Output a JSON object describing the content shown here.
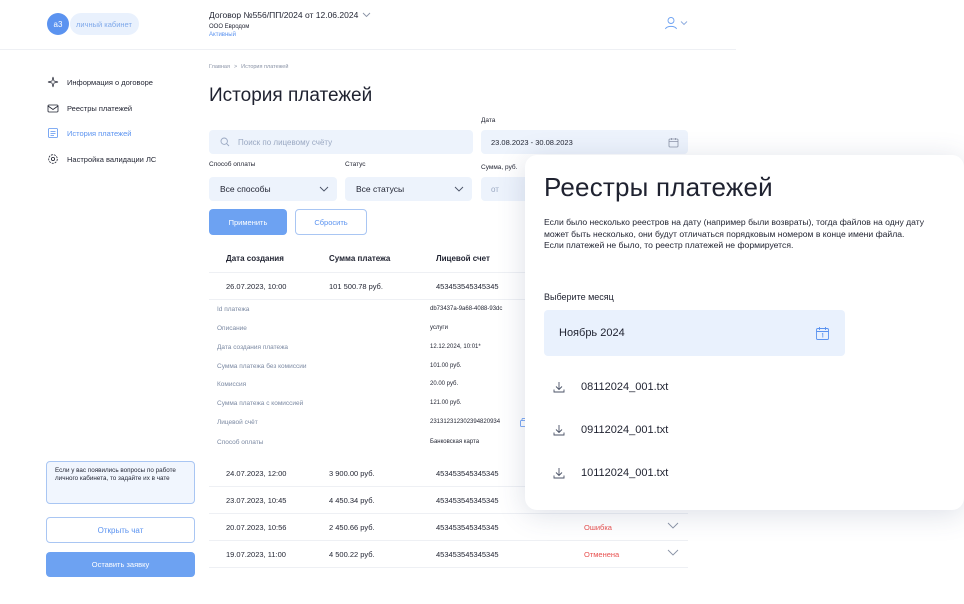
{
  "header": {
    "avatar_initials": "а3",
    "cabinet_label": "личный кабинет",
    "contract_title": "Договор №556/ПП/2024 от 12.06.2024",
    "org_name": "ООО Евродом",
    "contract_status": "Активный"
  },
  "sidebar": {
    "items": [
      {
        "label": "Информация о договоре",
        "icon": "sparkle-icon"
      },
      {
        "label": "Реестры платежей",
        "icon": "envelope-icon"
      },
      {
        "label": "История платежей",
        "icon": "list-icon"
      },
      {
        "label": "Настройка валидации ЛС",
        "icon": "gear-icon"
      }
    ],
    "help_text": "Если у вас появились вопросы по работе личного кабинета, то задайте их в чате",
    "chat_label": "Открыть чат",
    "request_label": "Оставить заявку"
  },
  "main": {
    "breadcrumbs": [
      "Главная",
      ">",
      "История платежей"
    ],
    "title": "История платежей",
    "search_placeholder": "Поиск по лицевому счёту",
    "date_label": "Дата",
    "date_value": "23.08.2023 - 30.08.2023",
    "payment_method_label": "Способ оплаты",
    "payment_method_value": "Все способы",
    "status_label": "Статус",
    "status_value": "Все статусы",
    "sum_label": "Сумма, руб.",
    "sum_from_placeholder": "от",
    "apply_label": "Применить",
    "reset_label": "Сбросить"
  },
  "table": {
    "columns": [
      "Дата создания",
      "Сумма платежа",
      "Лицевой счет"
    ],
    "first_row": {
      "date": "26.07.2023, 10:00",
      "sum": "101 500.78 руб.",
      "account": "453453545345345"
    },
    "details": [
      {
        "key": "Id платежа",
        "value": "db73437a-9a68-4088-93dc"
      },
      {
        "key": "Описание",
        "value": "услуги"
      },
      {
        "key": "Дата создания платежа",
        "value": "12.12.2024, 10:01*"
      },
      {
        "key": "Сумма платежа без комиссии",
        "value": "101.00 руб."
      },
      {
        "key": "Комиссия",
        "value": "20.00 руб."
      },
      {
        "key": "Сумма платежа с комиссией",
        "value": "121.00 руб."
      },
      {
        "key": "Лицевой счёт",
        "value": "231312312302394820934"
      },
      {
        "key": "Способ оплаты",
        "value": "Банковская карта"
      }
    ],
    "rows": [
      {
        "date": "24.07.2023, 12:00",
        "sum": "3 900.00 руб.",
        "account": "453453545345345",
        "status": ""
      },
      {
        "date": "23.07.2023, 10:45",
        "sum": "4 450.34 руб.",
        "account": "453453545345345",
        "status": ""
      },
      {
        "date": "20.07.2023, 10:56",
        "sum": "2 450.66 руб.",
        "account": "453453545345345",
        "status": "Ошибка"
      },
      {
        "date": "19.07.2023, 11:00",
        "sum": "4 500.22 руб.",
        "account": "453453545345345",
        "status": "Отменена"
      }
    ]
  },
  "modal": {
    "title": "Реестры платежей",
    "desc_1": "Если было несколько реестров на дату (например были возвраты), тогда файлов на одну дату может быть несколько, они будут отличаться порядковым номером в конце имени файла.",
    "desc_2": "Если платежей не было, то реестр платежей не формируется.",
    "month_label": "Выберите месяц",
    "month_value": "Ноябрь 2024",
    "files": [
      "08112024_001.txt",
      "09112024_001.txt",
      "10112024_001.txt"
    ]
  },
  "colors": {
    "accent": "#5b93f0",
    "error": "#e8504f"
  }
}
